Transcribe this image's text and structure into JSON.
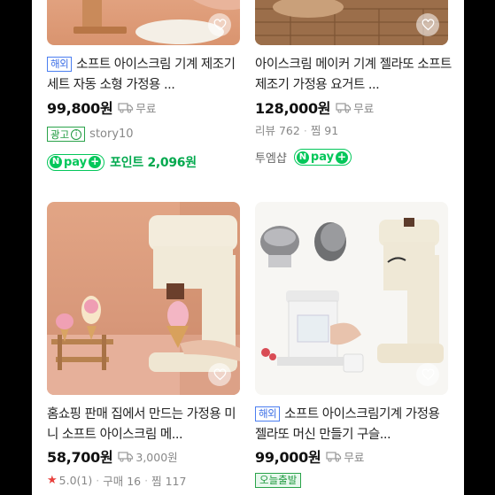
{
  "products": [
    {
      "foreign_badge": "해외",
      "title": "소프트 아이스크림 기계 제조기 세트 자동 소형 가정용 ...",
      "price": "99,800원",
      "shipping": "무료",
      "ad_label": "광고",
      "ad_info": "i",
      "seller": "story10",
      "npay_label": "pay",
      "point_text": "포인트 2,096원"
    },
    {
      "title": "아이스크림 메이커 기계 젤라또 소프트 제조기 가정용 요거트 ...",
      "price": "128,000원",
      "shipping": "무료",
      "review_label": "리뷰 762",
      "zzim_label": "찜 91",
      "shop_name": "투엠샵",
      "npay_label": "pay"
    },
    {
      "title": "홈쇼핑 판매 집에서 만드는 가정용 미니 소프트 아이스크림 메...",
      "price": "58,700원",
      "shipping": "3,000원",
      "rating": "5.0(1)",
      "purchase_label": "구매 16",
      "zzim_label": "찜 117"
    },
    {
      "foreign_badge": "해외",
      "title": "소프트 아이스크림기계 가정용 젤라또 머신 만들기 구슬...",
      "price": "99,000원",
      "shipping": "무료",
      "today_badge": "오늘출발"
    }
  ],
  "colors": {
    "npay_green": "#03c75a",
    "foreign_blue": "#3c6fe6",
    "star_red": "#e8403c"
  }
}
